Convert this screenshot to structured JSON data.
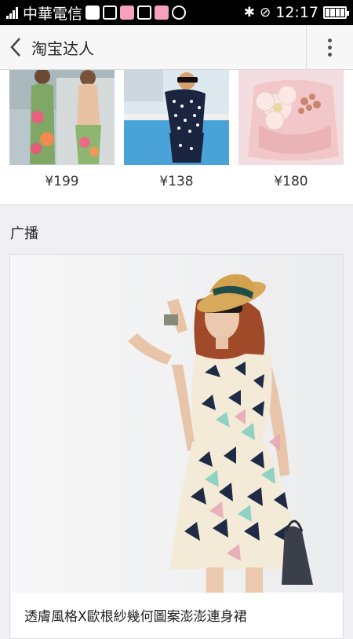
{
  "status_bar": {
    "carrier": "中華電信",
    "time": "12:17",
    "icons": [
      "signal-icon",
      "message-icon",
      "facebook-icon",
      "camera-icon",
      "mail-icon",
      "app-icon",
      "location-icon",
      "bluetooth-icon",
      "mute-icon",
      "battery-icon"
    ]
  },
  "nav": {
    "title": "淘宝达人",
    "back_icon": "chevron-left-icon",
    "more_icon": "more-vertical-icon"
  },
  "products": [
    {
      "price": "¥199"
    },
    {
      "price": "¥138"
    },
    {
      "price": "¥180"
    }
  ],
  "section": {
    "title": "广播"
  },
  "feed_item": {
    "caption": "透膚風格X歐根紗幾何圖案澎澎連身裙"
  },
  "colors": {
    "status_bg": "#000000",
    "nav_bg": "#f7f7f7",
    "page_bg": "#efeff4"
  }
}
